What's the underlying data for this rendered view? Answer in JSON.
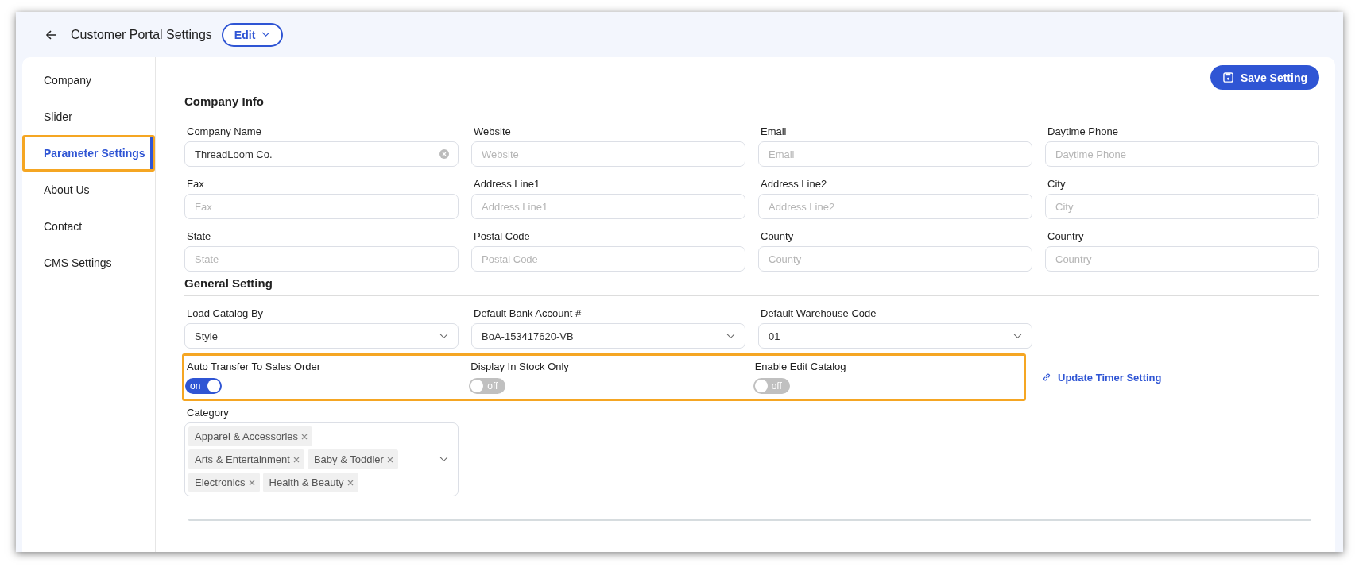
{
  "header": {
    "title": "Customer Portal Settings",
    "edit_button": "Edit"
  },
  "sidebar": {
    "items": [
      {
        "label": "Company",
        "selected": false,
        "highlighted": false
      },
      {
        "label": "Slider",
        "selected": false,
        "highlighted": false
      },
      {
        "label": "Parameter Settings",
        "selected": true,
        "highlighted": true
      },
      {
        "label": "About Us",
        "selected": false,
        "highlighted": false
      },
      {
        "label": "Contact",
        "selected": false,
        "highlighted": false
      },
      {
        "label": "CMS Settings",
        "selected": false,
        "highlighted": false
      }
    ]
  },
  "save_button": "Save Setting",
  "company_info": {
    "title": "Company Info",
    "fields": [
      {
        "label": "Company Name",
        "value": "ThreadLoom Co."
      },
      {
        "label": "Website",
        "placeholder": "Website"
      },
      {
        "label": "Email",
        "placeholder": "Email"
      },
      {
        "label": "Daytime Phone",
        "placeholder": "Daytime Phone"
      },
      {
        "label": "Fax",
        "placeholder": "Fax"
      },
      {
        "label": "Address Line1",
        "placeholder": "Address Line1"
      },
      {
        "label": "Address Line2",
        "placeholder": "Address Line2"
      },
      {
        "label": "City",
        "placeholder": "City"
      },
      {
        "label": "State",
        "placeholder": "State"
      },
      {
        "label": "Postal Code",
        "placeholder": "Postal Code"
      },
      {
        "label": "County",
        "placeholder": "County"
      },
      {
        "label": "Country",
        "placeholder": "Country"
      }
    ]
  },
  "general_setting": {
    "title": "General Setting",
    "selects": [
      {
        "label": "Load Catalog By",
        "value": "Style"
      },
      {
        "label": "Default Bank Account #",
        "value": "BoA-153417620-VB"
      },
      {
        "label": "Default Warehouse Code",
        "value": "01"
      }
    ],
    "toggles_highlighted": true,
    "toggles": [
      {
        "label": "Auto Transfer To Sales Order",
        "on": true,
        "text": "on"
      },
      {
        "label": "Display In Stock Only",
        "on": false,
        "text": "off"
      },
      {
        "label": "Enable Edit Catalog",
        "on": false,
        "text": "off"
      }
    ],
    "link": "Update Timer Setting",
    "category": {
      "label": "Category",
      "tags": [
        "Apparel & Accessories",
        "Arts & Entertainment",
        "Baby & Toddler",
        "Electronics",
        "Health & Beauty"
      ]
    }
  }
}
